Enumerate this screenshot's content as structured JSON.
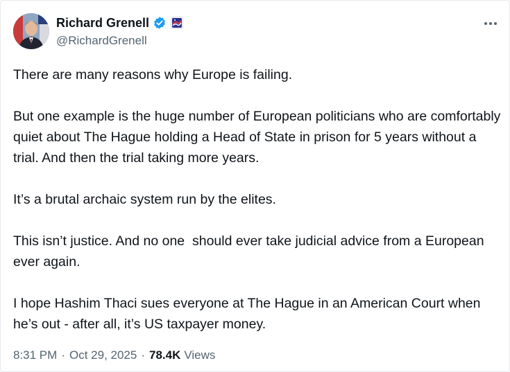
{
  "author": {
    "display_name": "Richard Grenell",
    "handle": "@RichardGrenell",
    "verified_icon": "verified-badge-icon",
    "affiliation_icon": "affiliation-badge-icon",
    "verified_color": "#1d9bf0"
  },
  "more_icon": "more-horizontal-icon",
  "tweet": {
    "paragraphs": [
      "There are many reasons why Europe is failing.",
      "But one example is the huge number of European politicians who are comfortably quiet about The Hague holding a Head of State in prison for 5 years without a trial. And then the trial taking more years.",
      "It’s a brutal archaic system run by the elites.",
      "This isn’t justice. And no one  should ever take judicial advice from a European ever again.",
      "I hope Hashim Thaci sues everyone at The Hague in an American Court when he’s out - after all, it’s US taxpayer money."
    ]
  },
  "meta": {
    "time": "8:31 PM",
    "date": "Oct 29, 2025",
    "separator": "·",
    "views_count": "78.4K",
    "views_label": "Views"
  }
}
